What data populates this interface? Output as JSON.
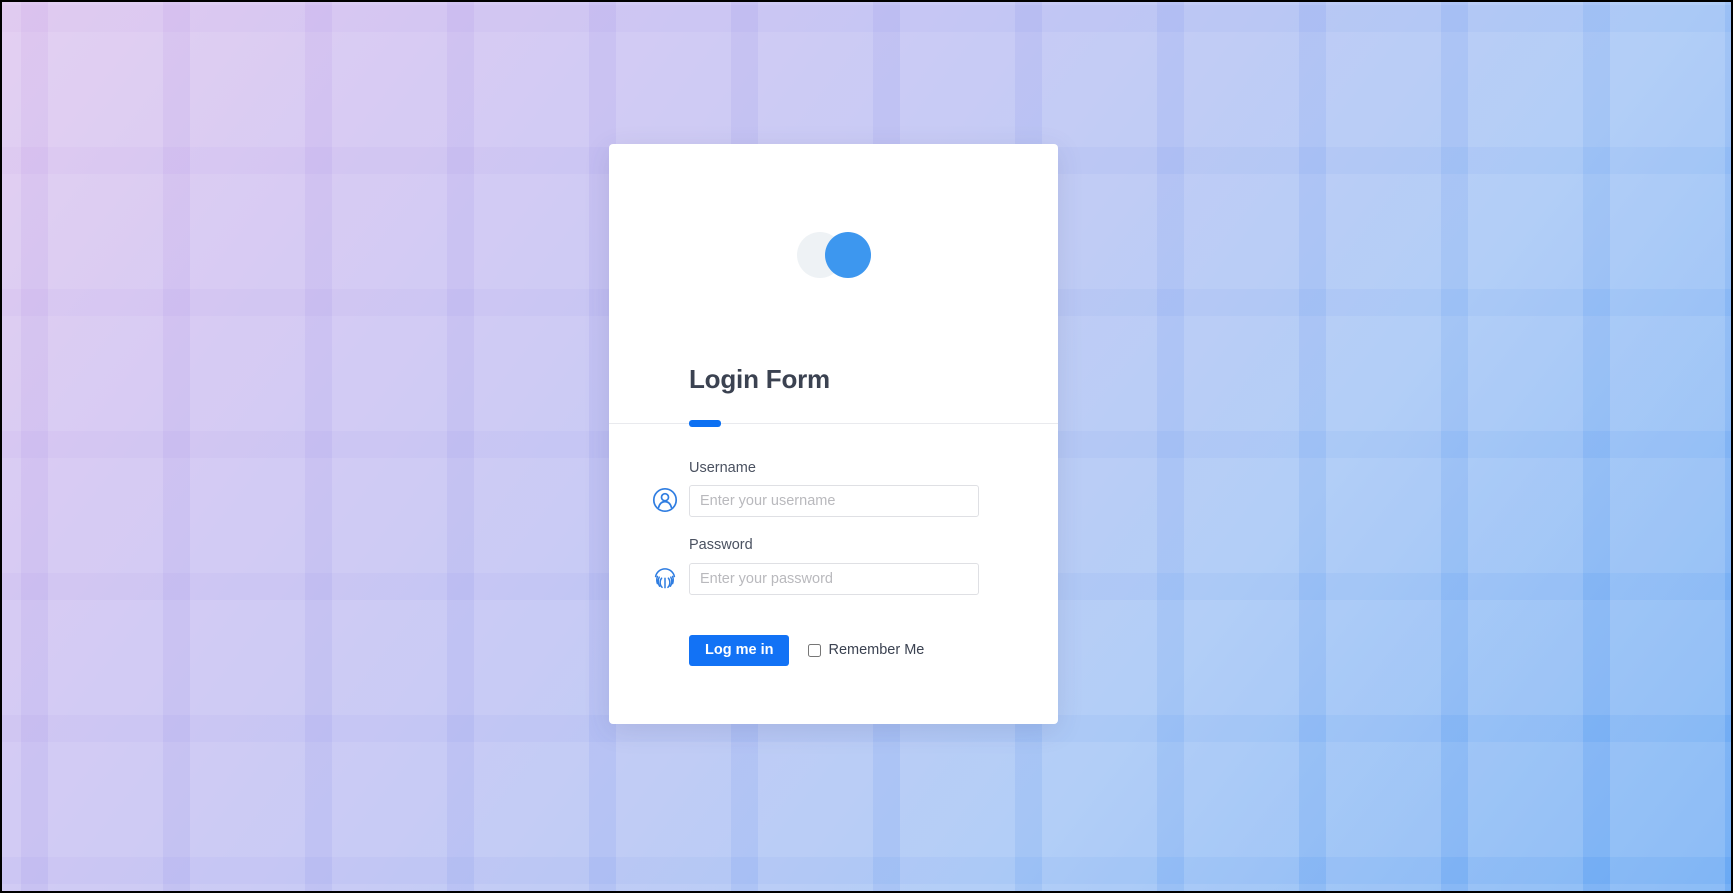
{
  "background": {
    "gradient_start": "#dcc2ee",
    "gradient_end": "#6aa9f4",
    "pattern": "light-square-grid"
  },
  "card": {
    "logo": {
      "back_circle_icon": "circle-gray-icon",
      "front_circle_icon": "circle-blue-icon",
      "back_color": "#eef2f5",
      "front_color": "#3d97ef"
    },
    "title": "Login Form",
    "accent_color": "#0c70f2",
    "fields": [
      {
        "icon": "user-circle-icon",
        "label": "Username",
        "placeholder": "Enter your username",
        "value": "",
        "type": "text"
      },
      {
        "icon": "fingerprint-icon",
        "label": "Password",
        "placeholder": "Enter your password",
        "value": "",
        "type": "password"
      }
    ],
    "actions": {
      "submit_label": "Log me in",
      "submit_color": "#1272f5",
      "remember_label": "Remember Me",
      "remember_checked": false
    }
  }
}
